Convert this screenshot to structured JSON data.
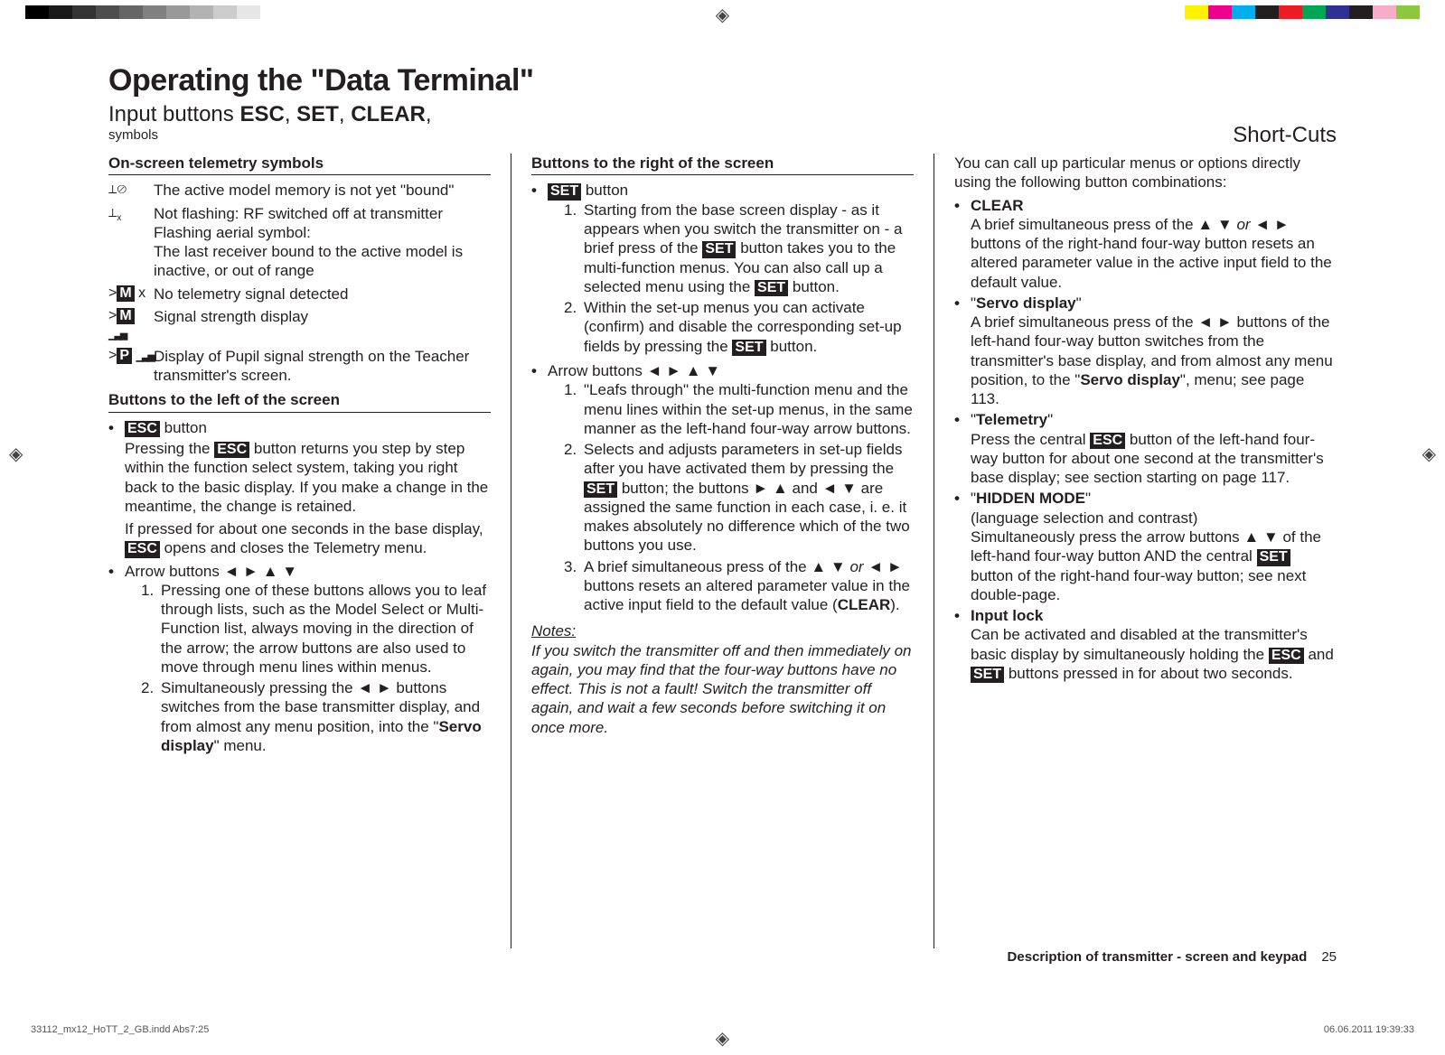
{
  "header": {
    "title": "Operating the \"Data Terminal\"",
    "subtitle_prefix": "Input buttons ",
    "subtitle_btn1": "ESC",
    "subtitle_sep1": ", ",
    "subtitle_btn2": "SET",
    "subtitle_sep2": ", ",
    "subtitle_btn3": "CLEAR",
    "subtitle_suffix": ",",
    "subsub": "symbols",
    "shortcuts_title": "Short-Cuts"
  },
  "col1": {
    "head1": "On-screen telemetry symbols",
    "sym1": "The active model memory is not yet \"bound\"",
    "sym2a": "Not flashing: RF switched off at transmitter",
    "sym2b": "Flashing aerial symbol:",
    "sym2c": "The last receiver bound to the active model is inactive, or out of range",
    "sym3": "No telemetry signal detected",
    "sym4": "Signal strength display",
    "sym5": "Display of Pupil signal strength on the Teacher transmitter's screen.",
    "head2": "Buttons to the left of the screen",
    "esc_label": "ESC",
    "esc_btn_suffix": " button",
    "esc_p1a": "Pressing the ",
    "esc_p1b": " button returns you step by step within the function select system, taking you right back to the basic display. If you make a change in the meantime, the change is retained.",
    "esc_p2a": "If pressed for about one seconds in the base display, ",
    "esc_p2b": " opens and closes the Telemetry menu.",
    "arrow_label": "Arrow buttons ◄ ► ▲ ▼",
    "arrow_1": "Pressing one of these buttons allows you to leaf through lists, such as the Model Select or Multi-Function list, always moving in the direction of the arrow; the arrow buttons are also used to move through menu lines within menus.",
    "arrow_2a": "Simultaneously pressing the ◄ ► buttons switches from the base transmitter display, and from almost any menu position, into the \"",
    "arrow_2b": "Servo display",
    "arrow_2c": "\" menu."
  },
  "col2": {
    "head": "Buttons to the right of the screen",
    "set_label": "SET",
    "set_btn_suffix": " button",
    "set_1a": "Starting from the base screen display - as it appears when you switch the transmitter on - a brief press of the ",
    "set_1b": " button takes you to the multi-function menus. You can also call up a selected menu using the ",
    "set_1c": " button.",
    "set_2a": "Within the set-up menus you can activate (confirm) and disable the corresponding set-up fields by pressing the ",
    "set_2b": " button.",
    "arrow_label": "Arrow buttons ◄ ► ▲ ▼",
    "arrow_1": "\"Leafs through\" the multi-function menu and the menu lines within the set-up menus, in the same manner as the left-hand four-way arrow buttons.",
    "arrow_2a": "Selects and adjusts parameters in set-up fields after you have activated them by pressing the ",
    "arrow_2b": " button; the buttons ► ▲ and ◄ ▼ are assigned the same function in each case, i. e. it makes absolutely no difference which of the two buttons you use.",
    "arrow_3a": "A brief simultaneous press of the ▲ ▼ ",
    "arrow_3or": "or",
    "arrow_3b": " ◄ ► buttons resets an altered parameter value in the active input field to the default value (",
    "arrow_3c": "CLEAR",
    "arrow_3d": ").",
    "notes_head": "Notes:",
    "notes_body": "If you switch the transmitter off and then immediately on again, you may find that the four-way buttons have no effect. This is not a fault! Switch the transmitter off again, and wait a few seconds before switching it on once more."
  },
  "col3": {
    "intro": "You can call up particular menus or options directly using the following button combinations:",
    "clear_label": "CLEAR",
    "clear_body": "A brief simultaneous press of the ▲ ▼ or ◄ ► buttons of the right-hand four-way button resets an altered parameter value in the active input field to the default value.",
    "clear_or": "or",
    "servo_label": "Servo display",
    "servo_body_a": "A brief simultaneous press of the ◄ ► buttons of the left-hand four-way button switches from the transmitter's base display, and from almost any menu position, to the \"",
    "servo_body_b": "Servo display",
    "servo_body_c": "\", menu; see page 113.",
    "telemetry_label": "Telemetry",
    "telemetry_body_a": "Press the central ",
    "telemetry_body_b": " button of the left-hand four-way button for about one second at the transmitter's base display; see section starting on page 117.",
    "hidden_label": "HIDDEN MODE",
    "hidden_sub": "(language selection and contrast)",
    "hidden_body_a": "Simultaneously press the arrow buttons ▲ ▼ of the left-hand four-way button AND the central ",
    "hidden_body_b": " button of the right-hand four-way button; see next double-page.",
    "inputlock_label": "Input lock",
    "inputlock_body_a": "Can be activated and disabled at the transmitter's basic display by simultaneously holding the ",
    "inputlock_body_b": " and ",
    "inputlock_body_c": " buttons pressed in for about two seconds."
  },
  "footer": {
    "desc": "Description of transmitter - screen and keypad",
    "page": "25",
    "file": "33112_mx12_HoTT_2_GB.indd   Abs7:25",
    "date": "06.06.2011   19:39:33"
  },
  "icons": {
    "sym1": "⟂⊘",
    "sym2": "⟂",
    "sym3_pre": ">",
    "sym3_m": "M",
    "sym3_post": " x",
    "sym4_pre": ">",
    "sym4_m": "M",
    "sym5_pre": ">",
    "sym5_p": "P"
  }
}
